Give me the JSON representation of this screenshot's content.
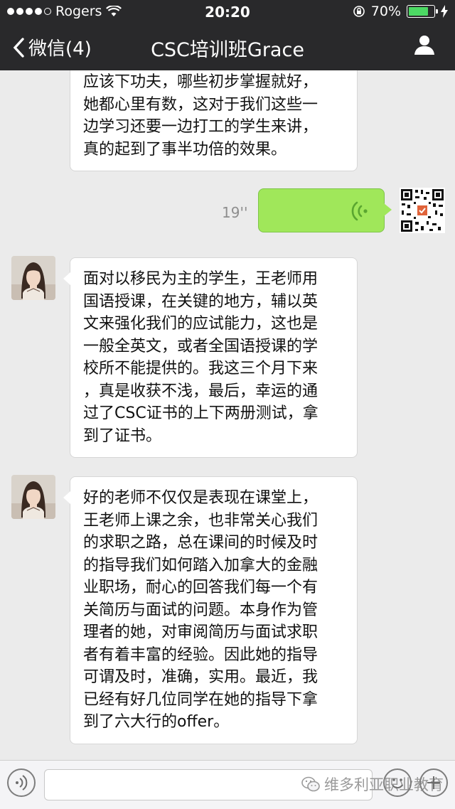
{
  "status_bar": {
    "carrier": "Rogers",
    "time": "20:20",
    "battery": "70%",
    "battery_level": 0.7
  },
  "nav": {
    "back_label": "微信(4)",
    "title": "CSC培训班Grace"
  },
  "messages": [
    {
      "lines": [
        "应该下功夫，哪些初步掌握就好，",
        "她都心里有数，这对于我们这些一",
        "边学习还要一边打工的学生来讲，",
        "真的起到了事半功倍的效果。"
      ]
    },
    {
      "voice_duration": "19''"
    },
    {
      "lines": [
        "面对以移民为主的学生，王老师用",
        "国语授课，在关键的地方，辅以英",
        "文来强化我们的应试能力，这也是",
        "一般全英文，或者全国语授课的学",
        "校所不能提供的。我这三个月下来",
        "，真是收获不浅，最后，幸运的通",
        "过了CSC证书的上下两册测试，拿",
        "到了证书。"
      ]
    },
    {
      "lines": [
        "好的老师不仅仅是表现在课堂上，",
        "王老师上课之余，也非常关心我们",
        "的求职之路，总在课间的时候及时",
        "的指导我们如何踏入加拿大的金融",
        "业职场，耐心的回答我们每一个有",
        "关简历与面试的问题。本身作为管",
        "理者的她，对审阅简历与面试求职",
        "者有着丰富的经验。因此她的指导",
        "可谓及时，准确，实用。最近，我",
        "已经有好几位同学在她的指导下拿",
        "到了六大行的offer。"
      ]
    }
  ],
  "watermark": "维多利亚职业教育",
  "colors": {
    "nav_bg": "#29292b",
    "chat_bg": "#ebebeb",
    "voice_bubble": "#a0e75a",
    "battery_green": "#4cd964"
  }
}
